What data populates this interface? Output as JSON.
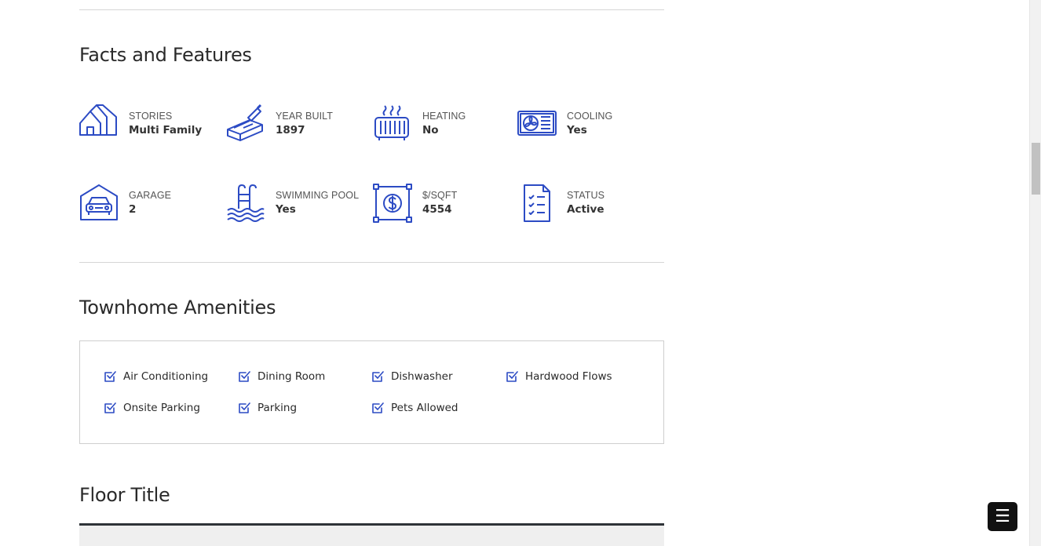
{
  "facts_section": {
    "title": "Facts and Features",
    "items": [
      {
        "icon": "houses-icon",
        "label": "STORIES",
        "value": "Multi Family"
      },
      {
        "icon": "brick-trowel-icon",
        "label": "YEAR BUILT",
        "value": "1897"
      },
      {
        "icon": "radiator-icon",
        "label": "HEATING",
        "value": "No"
      },
      {
        "icon": "air-conditioner-icon",
        "label": "COOLING",
        "value": "Yes"
      },
      {
        "icon": "garage-car-icon",
        "label": "GARAGE",
        "value": "2"
      },
      {
        "icon": "pool-ladder-icon",
        "label": "SWIMMING POOL",
        "value": "Yes"
      },
      {
        "icon": "dollar-area-icon",
        "label": "$/SQFT",
        "value": "4554"
      },
      {
        "icon": "checklist-icon",
        "label": "STATUS",
        "value": "Active"
      }
    ]
  },
  "amenities_section": {
    "title": "Townhome Amenities",
    "items": [
      "Air Conditioning",
      "Dining Room",
      "Dishwasher",
      "Hardwood Flows",
      "Onsite Parking",
      "Parking",
      "Pets Allowed"
    ]
  },
  "floor_section": {
    "title": "Floor Title"
  },
  "menu_button": {
    "icon": "hamburger-menu-icon",
    "glyph": "☰"
  },
  "colors": {
    "accent": "#2c4bc4",
    "divider": "#d6d6d6",
    "dark_bar": "#2e3338"
  }
}
